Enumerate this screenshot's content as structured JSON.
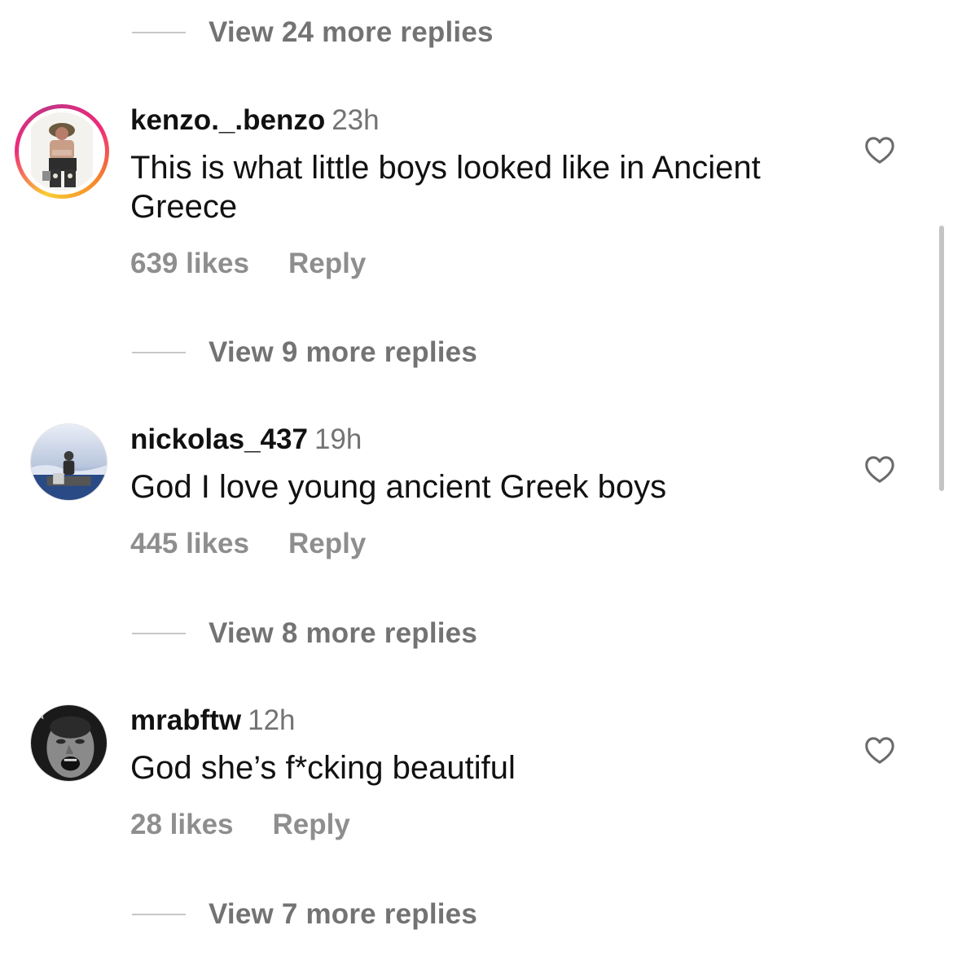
{
  "thread": {
    "view_replies_top": "View 24 more replies",
    "comments": [
      {
        "username": "kenzo._.benzo",
        "time": "23h",
        "text": "This is what little boys looked like in Ancient Greece",
        "likes": "639 likes",
        "reply_label": "Reply",
        "view_replies": "View 9 more replies",
        "avatar": "avatar-with-story-ring",
        "liked": false
      },
      {
        "username": "nickolas_437",
        "time": "19h",
        "text": "God I love young ancient Greek boys",
        "likes": "445 likes",
        "reply_label": "Reply",
        "view_replies": "View 8 more replies",
        "avatar": "avatar-plain",
        "liked": false
      },
      {
        "username": "mrabftw",
        "time": "12h",
        "text": "God she’s f*cking beautiful",
        "likes": "28 likes",
        "reply_label": "Reply",
        "view_replies": "View 7 more replies",
        "avatar": "avatar-plain",
        "liked": false
      }
    ]
  },
  "icons": {
    "like": "heart-outline-icon",
    "divider": "reply-thread-line"
  },
  "colors": {
    "text_primary": "#111111",
    "text_secondary": "#737373",
    "actions": "#8e8e8e",
    "divider": "#c7c7c7",
    "story_ring_start": "#f9ce34",
    "story_ring_end": "#c13584",
    "scrollbar": "#c4c4c4"
  }
}
